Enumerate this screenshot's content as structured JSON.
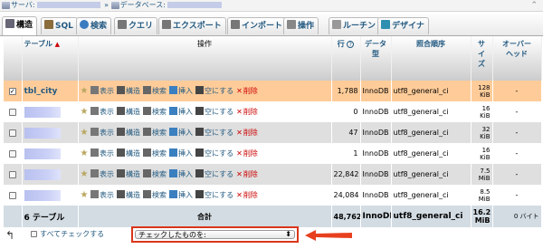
{
  "breadcrumb": {
    "server_label": "サーバ:",
    "sep": "»",
    "db_label": "データベース:"
  },
  "tabs": [
    {
      "label": "構造",
      "icon": "structure-icon",
      "active": true
    },
    {
      "label": "SQL",
      "icon": "sql-icon"
    },
    {
      "label": "検索",
      "icon": "search-icon"
    },
    {
      "label": "クエリ",
      "icon": "query-icon"
    },
    {
      "label": "エクスポート",
      "icon": "export-icon"
    },
    {
      "label": "インポート",
      "icon": "import-icon"
    },
    {
      "label": "操作",
      "icon": "wrench-icon"
    },
    {
      "label": "ルーチン",
      "icon": "routines-icon"
    },
    {
      "label": "デザイナ",
      "icon": "designer-icon"
    }
  ],
  "headers": {
    "table": "テーブル",
    "sort": "▲",
    "ops": "操作",
    "rows": "行",
    "help": "?",
    "type_l1": "データ",
    "type_l2": "型",
    "collation": "照合順序",
    "size_l1": "サ",
    "size_l2": "イ",
    "size_l3": "ズ",
    "overhead_l1": "オーバー",
    "overhead_l2": "ヘッド"
  },
  "actions": {
    "browse": "表示",
    "structure": "構造",
    "search": "検索",
    "insert": "挿入",
    "empty": "空にする",
    "drop": "削除"
  },
  "rows": [
    {
      "name": "tbl_city",
      "rows": "1,788",
      "engine": "InnoDB",
      "collation": "utf8_general_ci",
      "size_num": "128",
      "size_unit": "KiB",
      "overhead": "-",
      "checked": true
    },
    {
      "name": "",
      "rows": "0",
      "engine": "InnoDB",
      "collation": "utf8_general_ci",
      "size_num": "16",
      "size_unit": "KiB",
      "overhead": "-"
    },
    {
      "name": "",
      "rows": "47",
      "engine": "InnoDB",
      "collation": "utf8_general_ci",
      "size_num": "32",
      "size_unit": "KiB",
      "overhead": "-"
    },
    {
      "name": "",
      "rows": "1",
      "engine": "InnoDB",
      "collation": "utf8_general_ci",
      "size_num": "16",
      "size_unit": "KiB",
      "overhead": "-"
    },
    {
      "name": "",
      "rows": "22,842",
      "engine": "InnoDB",
      "collation": "utf8_general_ci",
      "size_num": "7.5",
      "size_unit": "MiB",
      "overhead": "-"
    },
    {
      "name": "",
      "rows": "24,084",
      "engine": "InnoDB",
      "collation": "utf8_general_ci",
      "size_num": "8.5",
      "size_unit": "MiB",
      "overhead": "-"
    }
  ],
  "footer": {
    "count": "6 テーブル",
    "total_label": "合計",
    "rows": "48,762",
    "engine": "InnoDB",
    "collation": "utf8_general_ci",
    "size_num": "16.2",
    "size_unit": "MiB",
    "overhead": "0 バイト"
  },
  "bottom": {
    "check_all": "すべてチェックする",
    "select_value": "チェックしたものを:"
  },
  "colors": {
    "link": "#235a81",
    "highlight_row": "#ffcc99",
    "callout": "#d9351a"
  }
}
